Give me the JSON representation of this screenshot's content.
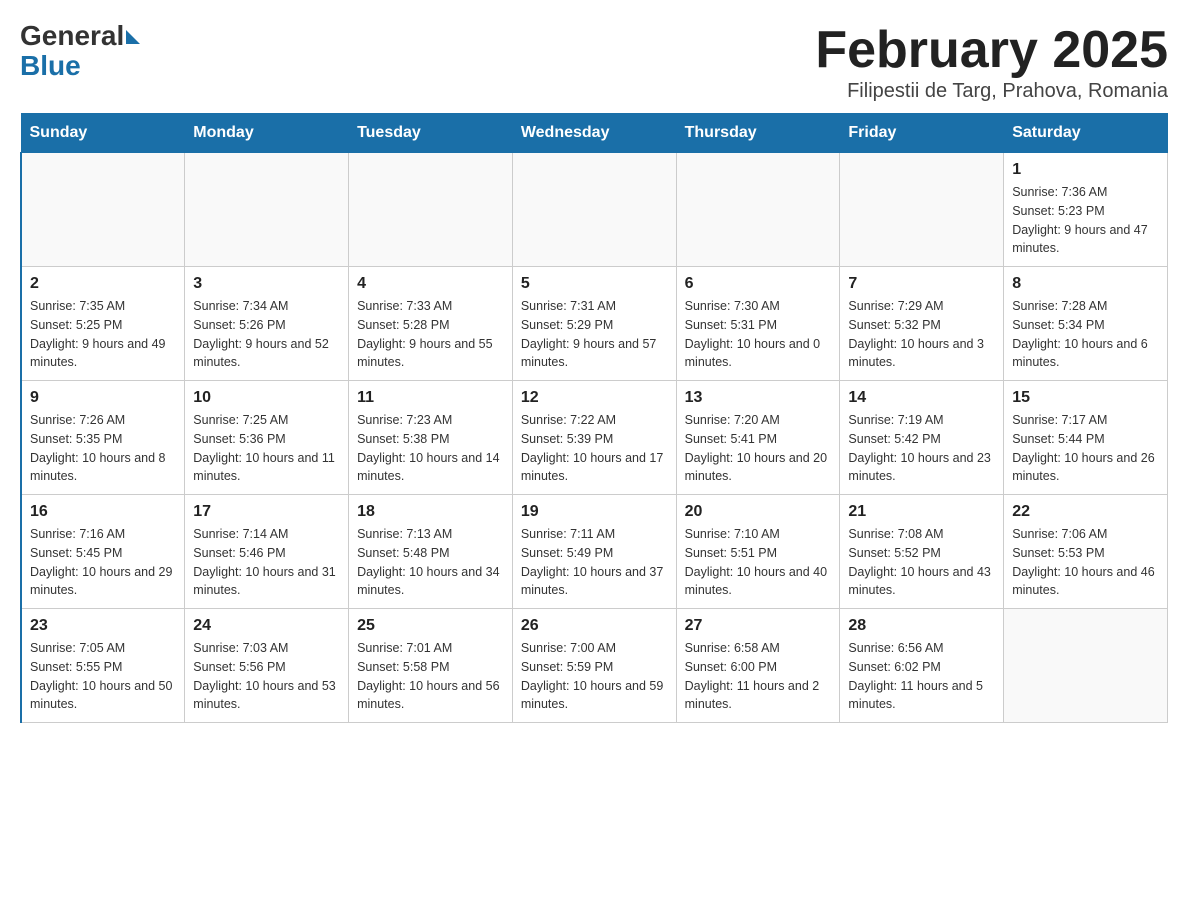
{
  "header": {
    "logo_general": "General",
    "logo_blue": "Blue",
    "month_title": "February 2025",
    "subtitle": "Filipestii de Targ, Prahova, Romania"
  },
  "days_of_week": [
    "Sunday",
    "Monday",
    "Tuesday",
    "Wednesday",
    "Thursday",
    "Friday",
    "Saturday"
  ],
  "weeks": [
    [
      {
        "day": "",
        "sunrise": "",
        "sunset": "",
        "daylight": ""
      },
      {
        "day": "",
        "sunrise": "",
        "sunset": "",
        "daylight": ""
      },
      {
        "day": "",
        "sunrise": "",
        "sunset": "",
        "daylight": ""
      },
      {
        "day": "",
        "sunrise": "",
        "sunset": "",
        "daylight": ""
      },
      {
        "day": "",
        "sunrise": "",
        "sunset": "",
        "daylight": ""
      },
      {
        "day": "",
        "sunrise": "",
        "sunset": "",
        "daylight": ""
      },
      {
        "day": "1",
        "sunrise": "Sunrise: 7:36 AM",
        "sunset": "Sunset: 5:23 PM",
        "daylight": "Daylight: 9 hours and 47 minutes."
      }
    ],
    [
      {
        "day": "2",
        "sunrise": "Sunrise: 7:35 AM",
        "sunset": "Sunset: 5:25 PM",
        "daylight": "Daylight: 9 hours and 49 minutes."
      },
      {
        "day": "3",
        "sunrise": "Sunrise: 7:34 AM",
        "sunset": "Sunset: 5:26 PM",
        "daylight": "Daylight: 9 hours and 52 minutes."
      },
      {
        "day": "4",
        "sunrise": "Sunrise: 7:33 AM",
        "sunset": "Sunset: 5:28 PM",
        "daylight": "Daylight: 9 hours and 55 minutes."
      },
      {
        "day": "5",
        "sunrise": "Sunrise: 7:31 AM",
        "sunset": "Sunset: 5:29 PM",
        "daylight": "Daylight: 9 hours and 57 minutes."
      },
      {
        "day": "6",
        "sunrise": "Sunrise: 7:30 AM",
        "sunset": "Sunset: 5:31 PM",
        "daylight": "Daylight: 10 hours and 0 minutes."
      },
      {
        "day": "7",
        "sunrise": "Sunrise: 7:29 AM",
        "sunset": "Sunset: 5:32 PM",
        "daylight": "Daylight: 10 hours and 3 minutes."
      },
      {
        "day": "8",
        "sunrise": "Sunrise: 7:28 AM",
        "sunset": "Sunset: 5:34 PM",
        "daylight": "Daylight: 10 hours and 6 minutes."
      }
    ],
    [
      {
        "day": "9",
        "sunrise": "Sunrise: 7:26 AM",
        "sunset": "Sunset: 5:35 PM",
        "daylight": "Daylight: 10 hours and 8 minutes."
      },
      {
        "day": "10",
        "sunrise": "Sunrise: 7:25 AM",
        "sunset": "Sunset: 5:36 PM",
        "daylight": "Daylight: 10 hours and 11 minutes."
      },
      {
        "day": "11",
        "sunrise": "Sunrise: 7:23 AM",
        "sunset": "Sunset: 5:38 PM",
        "daylight": "Daylight: 10 hours and 14 minutes."
      },
      {
        "day": "12",
        "sunrise": "Sunrise: 7:22 AM",
        "sunset": "Sunset: 5:39 PM",
        "daylight": "Daylight: 10 hours and 17 minutes."
      },
      {
        "day": "13",
        "sunrise": "Sunrise: 7:20 AM",
        "sunset": "Sunset: 5:41 PM",
        "daylight": "Daylight: 10 hours and 20 minutes."
      },
      {
        "day": "14",
        "sunrise": "Sunrise: 7:19 AM",
        "sunset": "Sunset: 5:42 PM",
        "daylight": "Daylight: 10 hours and 23 minutes."
      },
      {
        "day": "15",
        "sunrise": "Sunrise: 7:17 AM",
        "sunset": "Sunset: 5:44 PM",
        "daylight": "Daylight: 10 hours and 26 minutes."
      }
    ],
    [
      {
        "day": "16",
        "sunrise": "Sunrise: 7:16 AM",
        "sunset": "Sunset: 5:45 PM",
        "daylight": "Daylight: 10 hours and 29 minutes."
      },
      {
        "day": "17",
        "sunrise": "Sunrise: 7:14 AM",
        "sunset": "Sunset: 5:46 PM",
        "daylight": "Daylight: 10 hours and 31 minutes."
      },
      {
        "day": "18",
        "sunrise": "Sunrise: 7:13 AM",
        "sunset": "Sunset: 5:48 PM",
        "daylight": "Daylight: 10 hours and 34 minutes."
      },
      {
        "day": "19",
        "sunrise": "Sunrise: 7:11 AM",
        "sunset": "Sunset: 5:49 PM",
        "daylight": "Daylight: 10 hours and 37 minutes."
      },
      {
        "day": "20",
        "sunrise": "Sunrise: 7:10 AM",
        "sunset": "Sunset: 5:51 PM",
        "daylight": "Daylight: 10 hours and 40 minutes."
      },
      {
        "day": "21",
        "sunrise": "Sunrise: 7:08 AM",
        "sunset": "Sunset: 5:52 PM",
        "daylight": "Daylight: 10 hours and 43 minutes."
      },
      {
        "day": "22",
        "sunrise": "Sunrise: 7:06 AM",
        "sunset": "Sunset: 5:53 PM",
        "daylight": "Daylight: 10 hours and 46 minutes."
      }
    ],
    [
      {
        "day": "23",
        "sunrise": "Sunrise: 7:05 AM",
        "sunset": "Sunset: 5:55 PM",
        "daylight": "Daylight: 10 hours and 50 minutes."
      },
      {
        "day": "24",
        "sunrise": "Sunrise: 7:03 AM",
        "sunset": "Sunset: 5:56 PM",
        "daylight": "Daylight: 10 hours and 53 minutes."
      },
      {
        "day": "25",
        "sunrise": "Sunrise: 7:01 AM",
        "sunset": "Sunset: 5:58 PM",
        "daylight": "Daylight: 10 hours and 56 minutes."
      },
      {
        "day": "26",
        "sunrise": "Sunrise: 7:00 AM",
        "sunset": "Sunset: 5:59 PM",
        "daylight": "Daylight: 10 hours and 59 minutes."
      },
      {
        "day": "27",
        "sunrise": "Sunrise: 6:58 AM",
        "sunset": "Sunset: 6:00 PM",
        "daylight": "Daylight: 11 hours and 2 minutes."
      },
      {
        "day": "28",
        "sunrise": "Sunrise: 6:56 AM",
        "sunset": "Sunset: 6:02 PM",
        "daylight": "Daylight: 11 hours and 5 minutes."
      },
      {
        "day": "",
        "sunrise": "",
        "sunset": "",
        "daylight": ""
      }
    ]
  ]
}
